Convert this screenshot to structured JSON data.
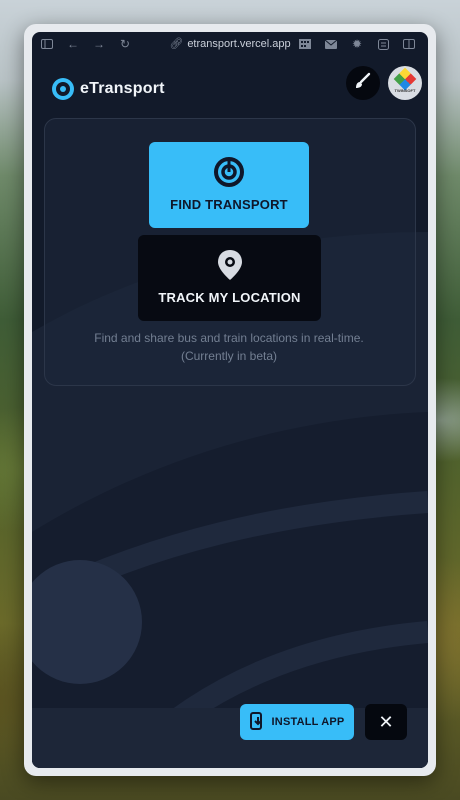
{
  "browser": {
    "url": "etransport.vercel.app",
    "icons": [
      "sidebar-icon",
      "back-icon",
      "forward-icon",
      "reload-icon",
      "link-icon",
      "grid-extension-icon",
      "mail-icon",
      "gear-extension-icon",
      "reader-icon",
      "split-view-icon"
    ]
  },
  "header": {
    "brand": "eTransport",
    "theme_button_icon": "paintbrush-icon",
    "avatar_text": "TWINSOFT"
  },
  "main": {
    "find_button_label": "FIND TRANSPORT",
    "find_button_icon": "target-icon",
    "track_button_label": "TRACK MY LOCATION",
    "track_button_icon": "location-pin-icon",
    "description_line1": "Find and share bus and train locations in real-time.",
    "description_line2": "(Currently in beta)"
  },
  "footer": {
    "install_label": "INSTALL APP",
    "install_icon": "phone-download-icon",
    "close_symbol": "✕"
  },
  "colors": {
    "accent": "#38bdf8",
    "background": "#121a2a",
    "dark_button": "#070a12",
    "muted_text": "#737f92"
  }
}
